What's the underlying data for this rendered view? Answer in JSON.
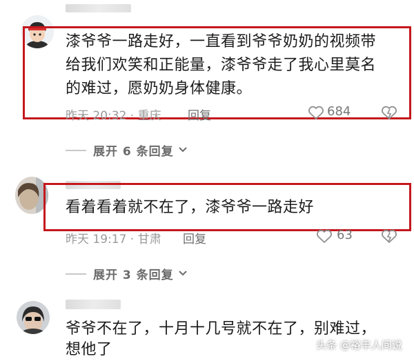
{
  "comments": [
    {
      "text": "漆爷爷一路走好，一直看到爷爷奶奶的视频带给我们欢笑和正能量，漆爷爷走了我心里莫名的难过，愿奶奶身体健康。",
      "line1": "漆爷爷一路走好，一直看到爷爷奶奶的视频带",
      "line2": "给我们欢笑和正能量，漆爷爷走了我心里莫名",
      "line3": "的难过，愿奶奶身体健康。",
      "time_location": "昨天 20:32 · 重庆",
      "reply_label": "回复",
      "likes": "684"
    },
    {
      "text": "看着看着就不在了，漆爷爷一路走好",
      "time_location": "昨天 19:17 · 甘肃",
      "reply_label": "回复",
      "likes": "63"
    },
    {
      "line1": "爷爷不在了，十月十几号就不在了，别难过，",
      "line2": "想他了"
    }
  ],
  "expand_replies": [
    {
      "label": "展开 6 条回复"
    },
    {
      "label": "展开 3 条回复"
    }
  ],
  "watermark": "头条 @裕丰人间说",
  "colors": {
    "highlight_box": "#c4171d"
  }
}
